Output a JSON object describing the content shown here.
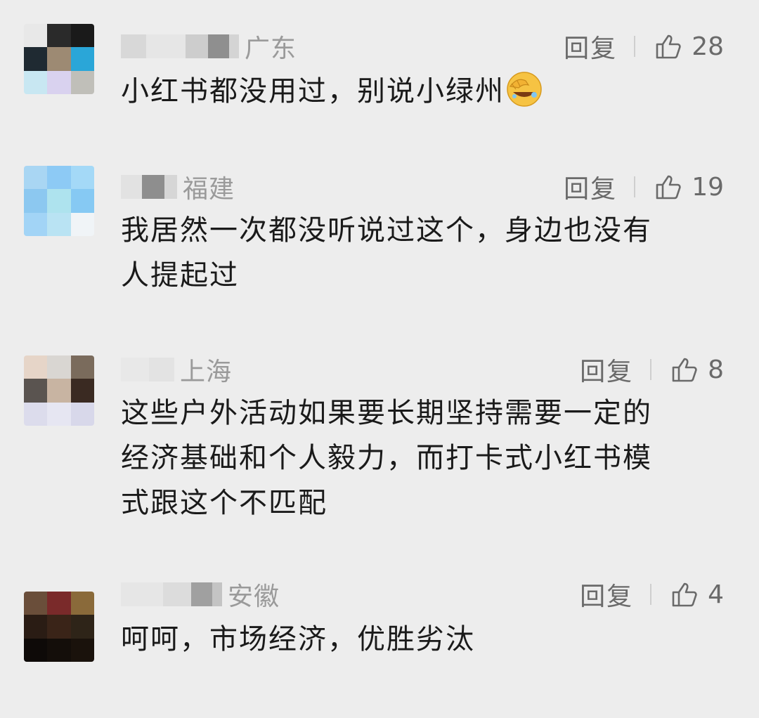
{
  "comments": [
    {
      "region": "广东",
      "reply_label": "回复",
      "likes": "28",
      "text": "小红书都没用过，别说小绿州",
      "emoji": "facepalm-laugh-emoji"
    },
    {
      "region": "福建",
      "reply_label": "回复",
      "likes": "19",
      "text_line1": "我居然一次都没听说过这个，身边也没有",
      "text_line2": "人提起过"
    },
    {
      "region": "上海",
      "reply_label": "回复",
      "likes": "8",
      "text_line1": "这些户外活动如果要长期坚持需要一定的",
      "text_line2": "经济基础和个人毅力，而打卡式小红书模",
      "text_line3": "式跟这个不匹配"
    },
    {
      "region": "安徽",
      "reply_label": "回复",
      "likes": "4",
      "text": "呵呵，市场经济，优胜劣汰"
    }
  ],
  "icons": {
    "like": "thumbs-up-outline-icon"
  },
  "colors": {
    "background": "#ededed",
    "text": "#1a1a1a",
    "meta": "#9a9a9a",
    "action": "#6a6a6a"
  }
}
